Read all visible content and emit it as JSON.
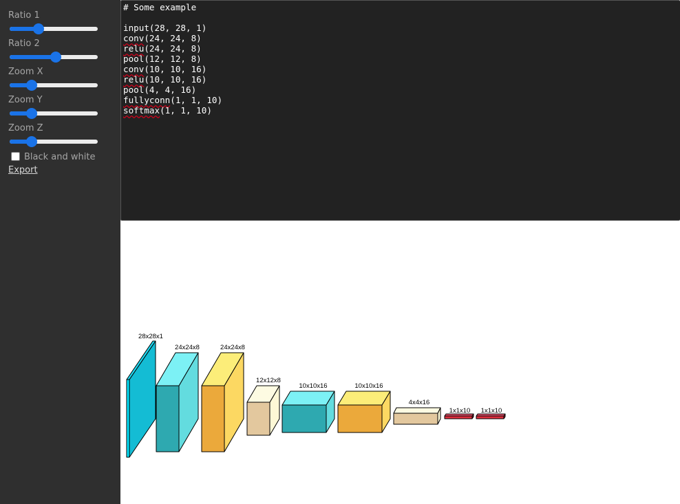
{
  "sidebar": {
    "controls": [
      {
        "label": "Ratio 1",
        "value": 0.33
      },
      {
        "label": "Ratio 2",
        "value": 0.52
      },
      {
        "label": "Zoom X",
        "value": 0.25
      },
      {
        "label": "Zoom Y",
        "value": 0.25
      },
      {
        "label": "Zoom Z",
        "value": 0.25
      }
    ],
    "black_and_white_label": "Black and white",
    "black_and_white_checked": false,
    "export_label": "Export"
  },
  "editor": {
    "lines": [
      {
        "fn": "",
        "text": "# Some example"
      },
      {
        "fn": "",
        "text": ""
      },
      {
        "fn": "",
        "text": "input(28, 28, 1)"
      },
      {
        "fn": "conv",
        "text": "(24, 24, 8)"
      },
      {
        "fn": "relu",
        "text": "(24, 24, 8)"
      },
      {
        "fn": "",
        "text": "pool(12, 12, 8)"
      },
      {
        "fn": "conv",
        "text": "(10, 10, 16)"
      },
      {
        "fn": "relu",
        "text": "(10, 10, 16)"
      },
      {
        "fn": "",
        "text": "pool(4, 4, 16)"
      },
      {
        "fn": "fullyconn",
        "text": "(1, 1, 10)"
      },
      {
        "fn": "softmax",
        "text": "(1, 1, 10)"
      }
    ]
  },
  "diagram": {
    "layers": [
      {
        "label": "28x28x1",
        "front": "#00e6ff",
        "top": "#1fd6ee",
        "side": "#14bcd4"
      },
      {
        "label": "24x24x8",
        "front": "#2ea9b0",
        "top": "#7cf1f5",
        "side": "#63dcdf"
      },
      {
        "label": "24x24x8",
        "front": "#eba93b",
        "top": "#fced79",
        "side": "#fcd862"
      },
      {
        "label": "12x12x8",
        "front": "#e3c89e",
        "top": "#fdfbe2",
        "side": "#fdf8d6"
      },
      {
        "label": "10x10x16",
        "front": "#2ea9b0",
        "top": "#7cf1f5",
        "side": "#63dcdf"
      },
      {
        "label": "10x10x16",
        "front": "#eba93b",
        "top": "#fced79",
        "side": "#fcd862"
      },
      {
        "label": "4x4x16",
        "front": "#e3c89e",
        "top": "#fdfbe2",
        "side": "#fdf8d6"
      },
      {
        "label": "1x1x10",
        "front": "#e0303f",
        "top": "#e2506a",
        "side": "#9b1e2a"
      },
      {
        "label": "1x1x10",
        "front": "#e0303f",
        "top": "#e2506a",
        "side": "#9b1e2a"
      }
    ]
  }
}
